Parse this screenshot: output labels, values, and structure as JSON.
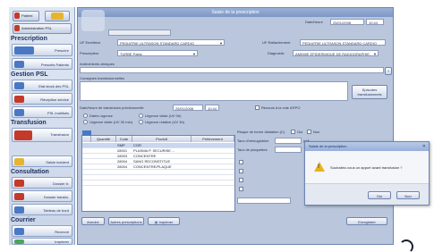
{
  "window": {
    "title": "Saisie de la prescription"
  },
  "sidebar": {
    "top_buttons": [
      {
        "label": "Patient",
        "icon": "patient-icon"
      },
      {
        "label": "Administration PSL",
        "icon": "admin-icon"
      }
    ],
    "sections": [
      {
        "title": "Prescription",
        "items": [
          {
            "label": "Prescrire",
            "icon": "prescribe-icon"
          },
          {
            "label": "Prescrits Patients",
            "icon": "list-icon"
          }
        ]
      },
      {
        "title": "Gestion PSL",
        "items": [
          {
            "label": "Etat stock des PSL",
            "icon": "stock-icon"
          },
          {
            "label": "Réception service",
            "icon": "reception-icon"
          },
          {
            "label": "PSL Inutilisés",
            "icon": "unused-icon"
          }
        ]
      },
      {
        "title": "Transfusion",
        "items": [
          {
            "label": "Transfusion",
            "icon": "transfusion-icon"
          },
          {
            "label": "Saisie incident",
            "icon": "incident-icon"
          }
        ]
      },
      {
        "title": "Consultation",
        "items": [
          {
            "label": "Dossier tr.",
            "icon": "file-icon"
          },
          {
            "label": "Dossier transfu.",
            "icon": "folder-icon"
          },
          {
            "label": "Tableau de bord",
            "icon": "dashboard-icon"
          }
        ]
      },
      {
        "title": "Courrier",
        "items": [
          {
            "label": "Recevoir",
            "icon": "mail-icon"
          },
          {
            "label": "Imprimer",
            "icon": "print-icon"
          }
        ]
      }
    ]
  },
  "form": {
    "date_label": "Date/heure",
    "date_value": "25/01/2008",
    "time_value": "10:44",
    "uf_label": "UF Emettrice",
    "uf_value": "PEDIATRIE ULTRASON STANDARD CARDIO",
    "uf_rattach_label": "UF Rattachement",
    "uf_rattach_value": "PEDIATRIE ULTRASON STANDARD CARDIO",
    "prescriber_label": "Prescripteur",
    "prescriber_value": "TURBE Patric",
    "diagnostic_label": "Diagnostic",
    "diagnostic_value": "ANEMIE EPIDERMIQUE DE RADIOGRAPHIE",
    "antecedents_label": "Antécédents cliniques",
    "comments_label": "Consignes transfusionnelles",
    "episodes_button": "Episodes transfusionnels",
    "date_transfusion_label": "Date/heure de transfusion prévisionnelle",
    "date_transfusion_value": "25/01/2008",
    "time_transfusion_value": "10:44",
    "urgent_label": "Recours à la voie d'EPO",
    "options": [
      "Dates urgence",
      "Urgence vitale (UV 0h)",
      "Urgence vitale (UV 30 min)",
      "Urgence relative (UV 3h)"
    ],
    "dilution_label": "Risque de forme dilatation (C)",
    "oui": "Oui",
    "non": "Non",
    "hemoglobin_label": "Taux d'hémoglobine",
    "hemoglobin_unit": "g/dl",
    "plaquettes_label": "Taux de plaquettes"
  },
  "table": {
    "columns": [
      "Quantité",
      "Code",
      "Produit",
      "Prélèvement"
    ],
    "rows": [
      {
        "qty": "",
        "code": "SMP",
        "product": "CGR",
        "extra": ""
      },
      {
        "qty": "",
        "code": "28001",
        "product": "PLASMA P. SECURISE ...",
        "extra": ""
      },
      {
        "qty": "",
        "code": "28003",
        "product": "CONCENTRE",
        "extra": ""
      },
      {
        "qty": "",
        "code": "28004",
        "product": "SANG RECONSTITUE",
        "extra": ""
      },
      {
        "qty": "",
        "code": "28004",
        "product": "CONCENTRE/PLAQUE",
        "extra": ""
      }
    ]
  },
  "footer_buttons": {
    "cancel": "Annuler",
    "other": "Autres prescriptions",
    "print": "Imprimer",
    "save": "Enregistrer"
  },
  "dialog": {
    "title": "Saisie de la prescription",
    "message": "Souhaitez-vous un apport avant transfusion ?",
    "yes": "Oui",
    "no": "Non"
  },
  "colors": {
    "accent": "#4a78c4",
    "warning": "#e8b321"
  }
}
